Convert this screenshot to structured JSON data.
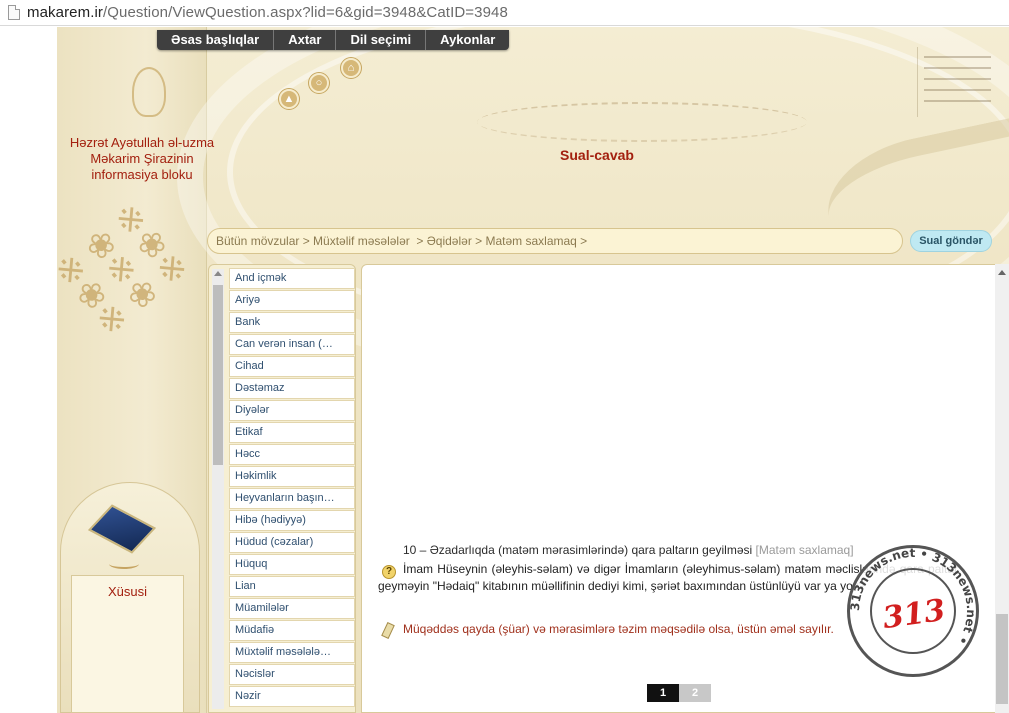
{
  "browser": {
    "url_host": "makarem.ir",
    "url_path": "/Question/ViewQuestion.aspx?lid=6&gid=3948&CatID=3948"
  },
  "nav": {
    "items": [
      "Əsas başlıqlar",
      "Axtar",
      "Dil seçimi",
      "Aykonlar"
    ]
  },
  "header": {
    "site_title": "Həzrət Ayətullah əl-uzma Məkarim Şirazinin informasiya bloku",
    "section_title": "Sual-cavab"
  },
  "breadcrumb": {
    "text": "Bütün mövzular > Müxtəlif məsələlər  > Əqidələr > Matəm saxlamaq >"
  },
  "send_question": {
    "label": "Sual göndər"
  },
  "categories": [
    "And içmək",
    "Ariyə",
    "Bank",
    "Can verən insan (…",
    "Cihad",
    "Dəstəmaz",
    "Diyələr",
    "Etikaf",
    "Həcc",
    "Həkimlik",
    "Heyvanların başın…",
    "Hibə (hədiyyə)",
    "Hüdud (cəzalar)",
    "Hüquq",
    "Lian",
    "Müamilələr",
    "Müdafiə",
    "Müxtəlif məsələlə…",
    "Nəcislər",
    "Nəzir"
  ],
  "sidebar": {
    "special_label": "Xüsusi"
  },
  "question": {
    "title": "10 – Əzadarlıqda (matəm mərasimlərində) qara paltarın geyilməsi",
    "category": "[Matəm saxlamaq]",
    "body": "İmam Hüseynin (əleyhis-səlam) və digər İmamların (əleyhimus-səlam) matəm məclislərində qara paltar geyməyin \"Hədaiq\" kitabının müəllifinin dediyi kimi, şəriət baxımından üstünlüyü var ya yox?",
    "answer": "Müqəddəs qayda (şüar) və mərasimlərə təzim məqsədilə olsa, üstün əməl sayılır."
  },
  "pager": {
    "pages": [
      "1",
      "2"
    ],
    "current": "1"
  },
  "stamp": {
    "number": "313",
    "ring_text": "313news.net • 313news.net • "
  },
  "colors": {
    "accent_red": "#a3200f",
    "nav_bg": "#3f3f3f",
    "link_blue": "#2f4f6f"
  }
}
